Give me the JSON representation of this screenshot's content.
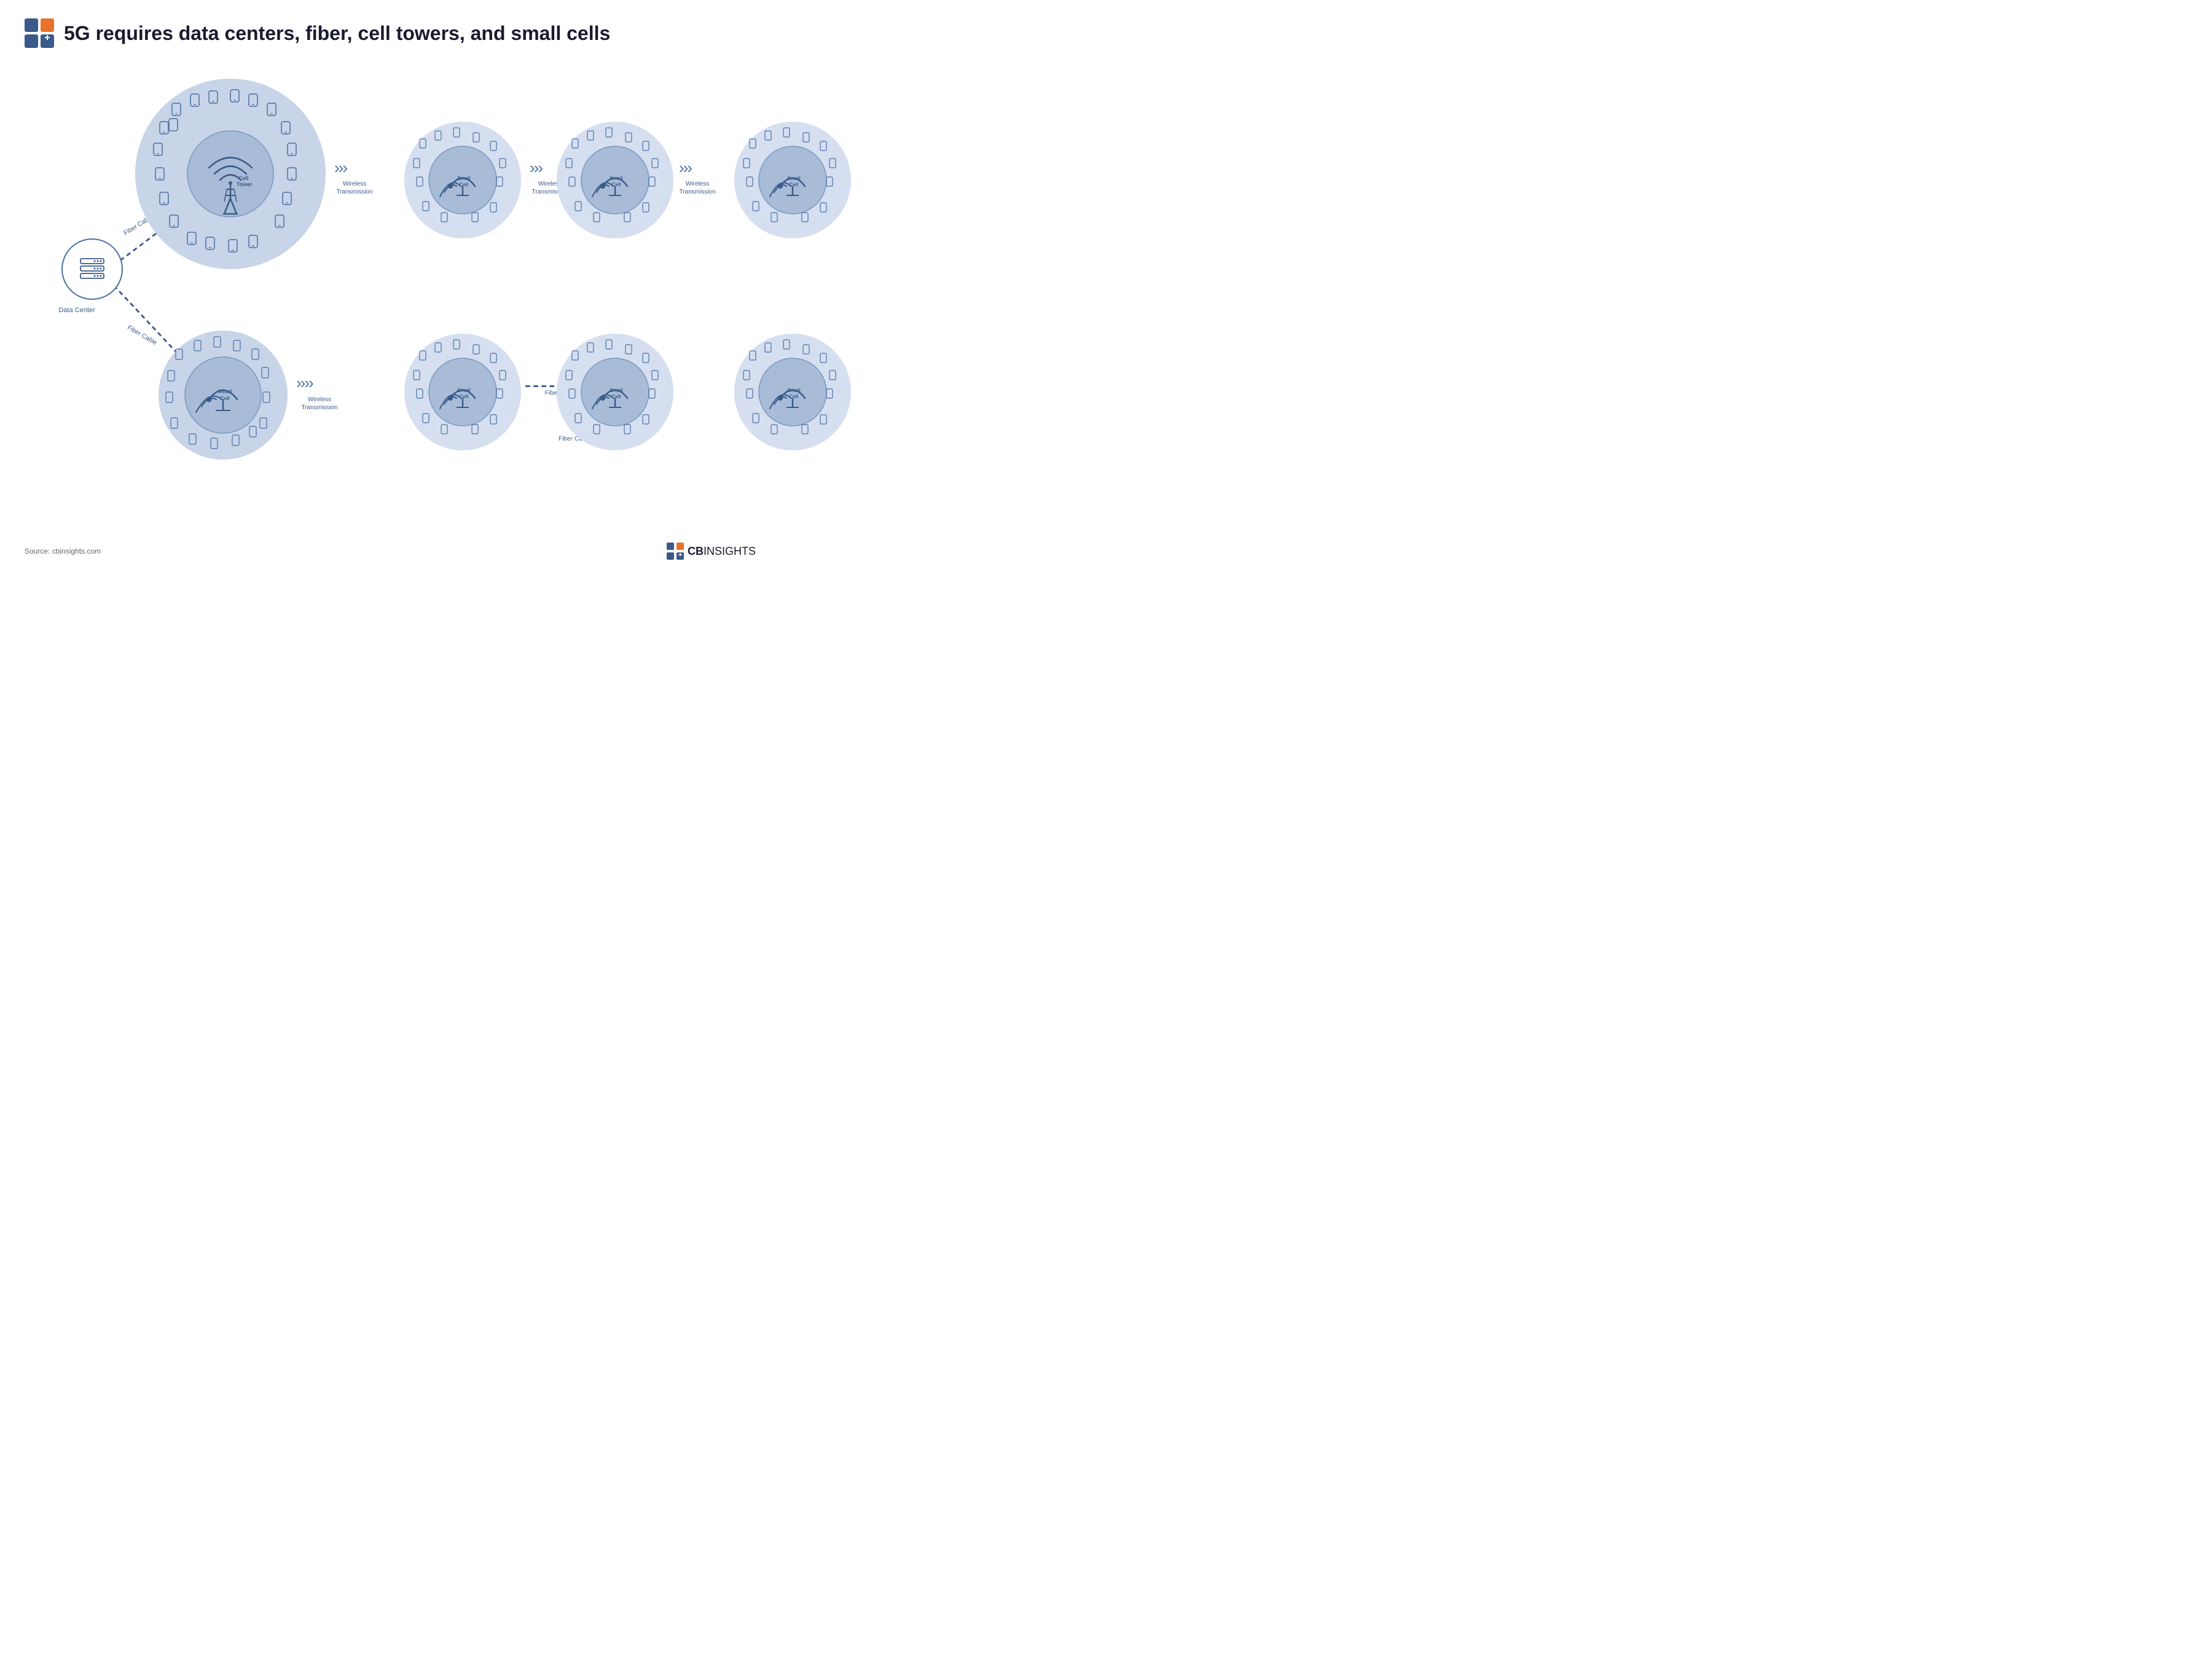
{
  "header": {
    "title": "5G requires data centers, fiber, cell towers, and small cells"
  },
  "nodes": {
    "data_center_label": "Data\nCenter",
    "cell_tower_label": "Cell\nTower",
    "small_cell_label": "Small\nCell"
  },
  "connectors": {
    "fiber_cable_1": "Fiber Cable",
    "fiber_cable_2": "Fiber Cable",
    "fiber_cable_3": "Fiber Cable",
    "wireless_1": "Wireless\nTransmission",
    "wireless_2": "Wireless\nTransmission",
    "wireless_3": "Wireless\nTransmission"
  },
  "footer": {
    "source": "Source: cbinsights.com",
    "brand": "CBINSIGHTS"
  },
  "colors": {
    "primary_blue": "#3a5a8a",
    "light_blue_circle": "#c8d4e8",
    "lighter_blue_circle": "#d5dff0",
    "accent_orange": "#e8722a",
    "accent_blue_dark": "#2a4a7a"
  }
}
